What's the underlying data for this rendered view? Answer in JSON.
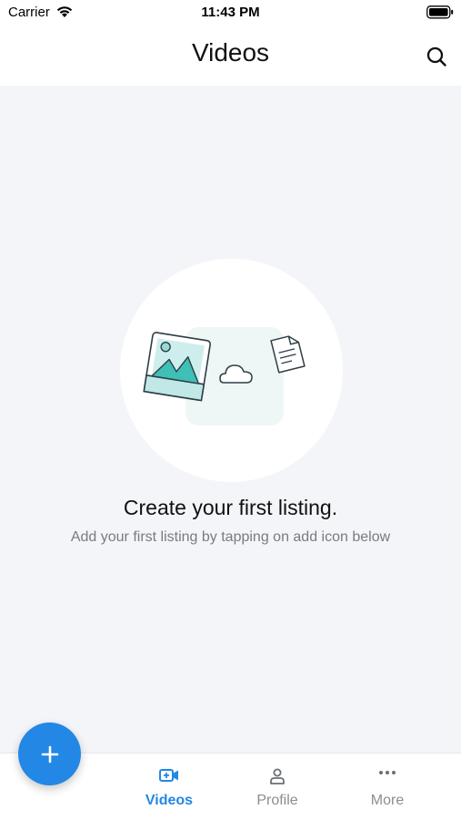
{
  "status_bar": {
    "carrier": "Carrier",
    "time": "11:43 PM"
  },
  "header": {
    "title": "Videos"
  },
  "empty_state": {
    "title": "Create your first listing.",
    "subtitle": "Add your first listing by tapping on add icon below"
  },
  "tabs": [
    {
      "label": "Videos",
      "icon": "video-camera-icon",
      "active": true
    },
    {
      "label": "Profile",
      "icon": "person-icon",
      "active": false
    },
    {
      "label": "More",
      "icon": "more-dots-icon",
      "active": false
    }
  ],
  "fab": {
    "icon": "plus-icon"
  },
  "colors": {
    "accent": "#2387e5",
    "background": "#f4f5f9",
    "illustration_teal": "#3fbfb5"
  }
}
